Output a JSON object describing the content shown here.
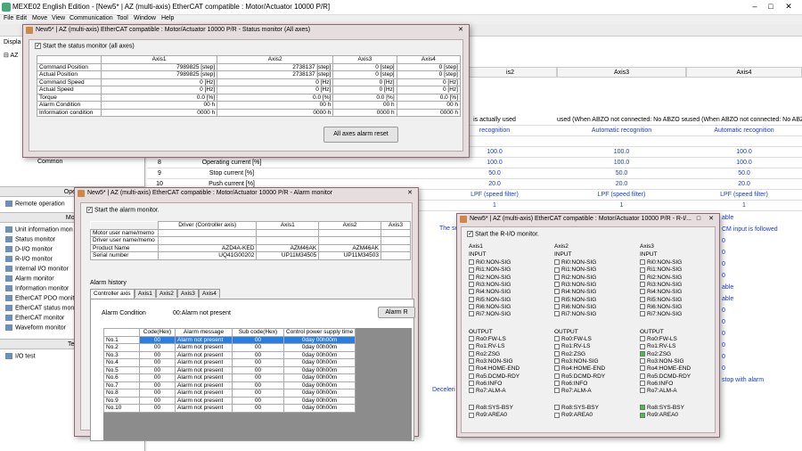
{
  "app": {
    "title": "MEXE02 English Edition - [New5* | AZ (multi-axis) EtherCAT compatible : Motor/Actuator 10000 P/R]",
    "menu": [
      "File",
      "Edit",
      "Move",
      "View",
      "Communication",
      "Tool",
      "Window",
      "Help"
    ]
  },
  "sidebar": {
    "top_label": "Displa",
    "tree_label": "AZ",
    "common": "Common",
    "sections": [
      "Opera",
      "Moni",
      "Tes"
    ],
    "items": [
      "Remote operation",
      "Unit information mon",
      "Status monitor",
      "D-I/O monitor",
      "R-I/O monitor",
      "Internal I/O monitor",
      "Alarm monitor",
      "Information monitor",
      "EtherCAT PDO monitor",
      "EtherCAT status mon",
      "EtherCAT monitor",
      "Waveform monitor",
      "I/O test"
    ]
  },
  "bg": {
    "headers": [
      "is2",
      "Axis3",
      "Axis4"
    ],
    "rows": [
      {
        "no": "",
        "name": "",
        "v": [
          "is actually used",
          "used (When ABZO not connected: No ABZO se",
          "used (When ABZO not connected: No ABZO se"
        ],
        "blue": false
      },
      {
        "no": "",
        "name": "",
        "v": [
          "recognition",
          "Automatic recognition",
          "Automatic recognition"
        ],
        "blue": true
      },
      {
        "no": "",
        "name": "",
        "v": [
          "",
          "",
          ""
        ],
        "blue": false
      },
      {
        "no": "",
        "name": "",
        "v": [
          "100.0",
          "100.0",
          "100.0"
        ],
        "blue": true
      },
      {
        "no": "8",
        "name": "Operating current [%]",
        "v": [
          "100.0",
          "100.0",
          "100.0"
        ],
        "blue": true
      },
      {
        "no": "9",
        "name": "Stop current [%]",
        "v": [
          "50.0",
          "50.0",
          "50.0"
        ],
        "blue": true
      },
      {
        "no": "10",
        "name": "Push current [%]",
        "v": [
          "20.0",
          "20.0",
          "20.0"
        ],
        "blue": true
      },
      {
        "no": "",
        "name": "",
        "v": [
          "LPF (speed filter)",
          "LPF (speed filter)",
          "LPF (speed filter)"
        ],
        "blue": true
      },
      {
        "no": "",
        "name": "",
        "v": [
          "1",
          "1",
          "1"
        ],
        "blue": true
      }
    ],
    "right_col": [
      "able",
      "CM input is followed",
      "0",
      "0",
      "0",
      "0",
      "able",
      "able",
      "0",
      "0",
      "0",
      "0",
      "0",
      "0",
      "stop with alarm"
    ],
    "decel": "Deceleri",
    "setting": "The setting of"
  },
  "status": {
    "title": "New5* | AZ (multi-axis) EtherCAT compatible : Motor/Actuator 10000 P/R - Status monitor (All axes)",
    "checkbox": "Start the status monitor (all axes)",
    "cols": [
      "Axis1",
      "Axis2",
      "Axis3",
      "Axis4"
    ],
    "rows": [
      {
        "label": "Command Position",
        "v": [
          "7989825 [step]",
          "2738137 [step]",
          "0 [step]",
          "0 [step]"
        ]
      },
      {
        "label": "Actual Position",
        "v": [
          "7989825 [step]",
          "2738137 [step]",
          "0 [step]",
          "0 [step]"
        ]
      },
      {
        "label": "Command Speed",
        "v": [
          "0 [Hz]",
          "0 [Hz]",
          "0 [Hz]",
          "0 [Hz]"
        ]
      },
      {
        "label": "Actual Speed",
        "v": [
          "0 [Hz]",
          "0 [Hz]",
          "0 [Hz]",
          "0 [Hz]"
        ]
      },
      {
        "label": "Torque",
        "v": [
          "0.0 [%]",
          "0.0 [%]",
          "0.0 [%]",
          "0.0 [%]"
        ]
      },
      {
        "label": "Alarm Condition",
        "v": [
          "00 h",
          "00 h",
          "00 h",
          "00 h"
        ]
      },
      {
        "label": "Information condition",
        "v": [
          "0000 h",
          "0000 h",
          "0000 h",
          "0000 h"
        ]
      }
    ],
    "reset_button": "All axes alarm reset"
  },
  "alarm": {
    "title": "New5* | AZ (multi-axis) EtherCAT compatible : Motor/Actuator 10000 P/R - Alarm monitor",
    "checkbox": "Start the alarm monitor.",
    "hdr": [
      "Driver (Controller axis)",
      "Axis1",
      "Axis2",
      "Axis3"
    ],
    "info_rows": [
      {
        "label": "Motor user name/memo",
        "v": [
          "",
          "",
          "",
          ""
        ]
      },
      {
        "label": "Driver user name/memo",
        "v": [
          "",
          "",
          "",
          ""
        ]
      },
      {
        "label": "Product Name",
        "v": [
          "AZD4A-KED",
          "AZM46AK",
          "AZM46AK",
          ""
        ]
      },
      {
        "label": "Serial number",
        "v": [
          "UQ41G00202",
          "UP11M34505",
          "UP11M34503",
          ""
        ]
      }
    ],
    "history_label": "Alarm history",
    "tabs": [
      "Controller axis",
      "Axis1",
      "Axis2",
      "Axis3",
      "Axis4"
    ],
    "cond_label": "Alarm Condition",
    "cond_value": "00:Alarm not present",
    "reset_btn": "Alarm R",
    "table_hdr": [
      "",
      "Code(Hex)",
      "Alarm message",
      "Sub code(Hex)",
      "Control power supply time"
    ],
    "rows": [
      {
        "no": "No.1",
        "code": "00",
        "msg": "Alarm not present",
        "sub": "00",
        "time": "0day 00h00m"
      },
      {
        "no": "No.2",
        "code": "00",
        "msg": "Alarm not present",
        "sub": "00",
        "time": "0day 00h00m"
      },
      {
        "no": "No.3",
        "code": "00",
        "msg": "Alarm not present",
        "sub": "00",
        "time": "0day 00h00m"
      },
      {
        "no": "No.4",
        "code": "00",
        "msg": "Alarm not present",
        "sub": "00",
        "time": "0day 00h00m"
      },
      {
        "no": "No.5",
        "code": "00",
        "msg": "Alarm not present",
        "sub": "00",
        "time": "0day 00h00m"
      },
      {
        "no": "No.6",
        "code": "00",
        "msg": "Alarm not present",
        "sub": "00",
        "time": "0day 00h00m"
      },
      {
        "no": "No.7",
        "code": "00",
        "msg": "Alarm not present",
        "sub": "00",
        "time": "0day 00h00m"
      },
      {
        "no": "No.8",
        "code": "00",
        "msg": "Alarm not present",
        "sub": "00",
        "time": "0day 00h00m"
      },
      {
        "no": "No.9",
        "code": "00",
        "msg": "Alarm not present",
        "sub": "00",
        "time": "0day 00h00m"
      },
      {
        "no": "No.10",
        "code": "00",
        "msg": "Alarm not present",
        "sub": "00",
        "time": "0day 00h00m"
      }
    ]
  },
  "rio": {
    "title": "New5* | AZ (multi-axis) EtherCAT compatible : Motor/Actuator 10000 P/R - R-I/...",
    "checkbox": "Start the R-I/O monitor.",
    "axes": [
      {
        "name": "Axis1",
        "input": [
          "Ri0:NON-SIG",
          "Ri1:NON-SIG",
          "Ri2:NON-SIG",
          "Ri3:NON-SIG",
          "Ri4:NON-SIG",
          "Ri5:NON-SIG",
          "Ri6:NON-SIG",
          "Ri7:NON-SIG"
        ],
        "output": [
          "Ro0:FW-LS",
          "Ro1:RV-LS",
          "Ro2:ZSG",
          "Ro3:NON-SIG",
          "Ro4:HOME-END",
          "Ro5:DCMD-RDY",
          "Ro6:INFO",
          "Ro7:ALM-A"
        ],
        "out_on": [
          false,
          false,
          false,
          false,
          false,
          false,
          false,
          false
        ],
        "extra": [
          "Ro8:SYS-BSY",
          "Ro9:AREA0"
        ],
        "extra_on": [
          false,
          false
        ]
      },
      {
        "name": "Axis2",
        "input": [
          "Ri0:NON-SIG",
          "Ri1:NON-SIG",
          "Ri2:NON-SIG",
          "Ri3:NON-SIG",
          "Ri4:NON-SIG",
          "Ri5:NON-SIG",
          "Ri6:NON-SIG",
          "Ri7:NON-SIG"
        ],
        "output": [
          "Ro0:FW-LS",
          "Ro1:RV-LS",
          "Ro2:ZSG",
          "Ro3:NON-SIG",
          "Ro4:HOME-END",
          "Ro5:DCMD-RDY",
          "Ro6:INFO",
          "Ro7:ALM-A"
        ],
        "out_on": [
          false,
          false,
          false,
          false,
          false,
          false,
          false,
          false
        ],
        "extra": [
          "Ro8:SYS-BSY",
          "Ro9:AREA0"
        ],
        "extra_on": [
          false,
          false
        ]
      },
      {
        "name": "Axis3",
        "input": [
          "Ri0:NON-SIG",
          "Ri1:NON-SIG",
          "Ri2:NON-SIG",
          "Ri3:NON-SIG",
          "Ri4:NON-SIG",
          "Ri5:NON-SIG",
          "Ri6:NON-SIG",
          "Ri7:NON-SIG"
        ],
        "output": [
          "Ro0:FW-LS",
          "Ro1:RV-LS",
          "Ro2:ZSG",
          "Ro3:NON-SIG",
          "Ro4:HOME-END",
          "Ro5:DCMD-RDY",
          "Ro6:INFO",
          "Ro7:ALM-A"
        ],
        "out_on": [
          false,
          false,
          true,
          false,
          false,
          false,
          false,
          false
        ],
        "extra": [
          "Ro8:SYS-BSY",
          "Ro9:AREA0"
        ],
        "extra_on": [
          true,
          true
        ]
      }
    ],
    "input_label": "INPUT",
    "output_label": "OUTPUT"
  }
}
